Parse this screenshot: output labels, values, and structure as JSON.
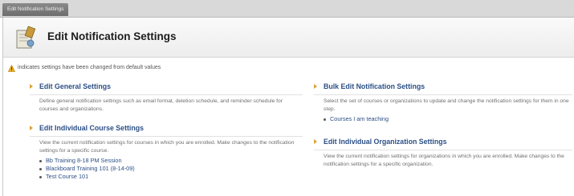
{
  "breadcrumb": {
    "label": "Edit Notification Settings"
  },
  "header": {
    "title": "Edit Notification Settings"
  },
  "legend": {
    "text": "indicates settings have been changed from default values"
  },
  "sections": {
    "general": {
      "title": "Edit General Settings",
      "description": "Define general notification settings such as email format, deletion schedule, and reminder schedule for courses and organizations."
    },
    "course": {
      "title": "Edit Individual Course Settings",
      "description": "View the current notification settings for courses in which you are enrolled. Make changes to the notification settings for a specific course.",
      "links": [
        "Bb Training 8-18 PM Session",
        "Blackboard Training 101 (8-14-09)",
        "Test Course 101"
      ]
    },
    "bulk": {
      "title": "Bulk Edit Notification Settings",
      "description": "Select the set of courses or organizations to update and change the notification settings for them in one step.",
      "links": [
        "Courses I am teaching"
      ]
    },
    "organization": {
      "title": "Edit Individual Organization Settings",
      "description": "View the current notification settings for organizations in which you are enrolled. Make changes to the notification settings for a specific organization."
    }
  },
  "colors": {
    "link": "#2b4f86",
    "arrow": "#d8a33a",
    "header_bg": "#ededed"
  },
  "icons": {
    "header": "notification-settings-icon",
    "legend": "warning-triangle-icon",
    "section": "arrow-right-icon"
  }
}
